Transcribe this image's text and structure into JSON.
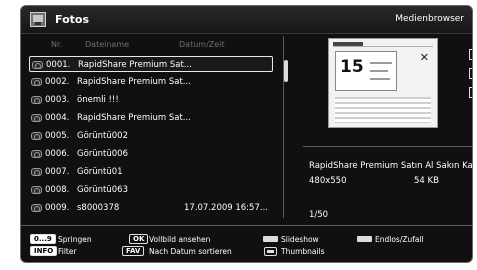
{
  "header": {
    "title": "Fotos",
    "right_label": "Medienbrowser"
  },
  "columns": {
    "number": "Nr.",
    "filename": "Dateiname",
    "datetime": "Datum/Zeit"
  },
  "files": [
    {
      "number": "0001.",
      "name": "RapidShare Premium Sat...",
      "date": "",
      "selected": true
    },
    {
      "number": "0002.",
      "name": "RapidShare Premium Sat...",
      "date": "",
      "selected": false
    },
    {
      "number": "0003.",
      "name": "önemli !!!",
      "date": "",
      "selected": false
    },
    {
      "number": "0004.",
      "name": "RapidShare Premium Sat...",
      "date": "",
      "selected": false
    },
    {
      "number": "0005.",
      "name": "Görüntü002",
      "date": "",
      "selected": false
    },
    {
      "number": "0006.",
      "name": "Görüntü006",
      "date": "",
      "selected": false
    },
    {
      "number": "0007.",
      "name": "Görüntü01",
      "date": "",
      "selected": false
    },
    {
      "number": "0008.",
      "name": "Görüntü063",
      "date": "",
      "selected": false
    },
    {
      "number": "0009.",
      "name": "s8000378",
      "date": "17.07.2009 16:57...",
      "selected": false
    }
  ],
  "preview": {
    "thumbnail_number": "15",
    "thumbnail_mark": "✕"
  },
  "info": {
    "filename": "RapidShare Premium Satın Al Sakın Kaçırma",
    "resolution": "480x550",
    "size": "54 KB",
    "page": "1/50"
  },
  "tools": [
    {
      "name": "rotate-icon"
    },
    {
      "name": "shuffle-icon"
    },
    {
      "name": "fullscreen-icon"
    }
  ],
  "footer": {
    "key_digits": "0...9",
    "label_digits": "Springen",
    "key_info": "INFO",
    "label_info": "Filter",
    "key_ok": "OK",
    "label_ok": "Vollbild ansehen",
    "key_fav": "FAV",
    "label_fav": "Nach Datum sortieren",
    "label_slideshow": "Slideshow",
    "label_thumbnails": "Thumbnails",
    "label_loop": "Endlos/Zufall"
  }
}
